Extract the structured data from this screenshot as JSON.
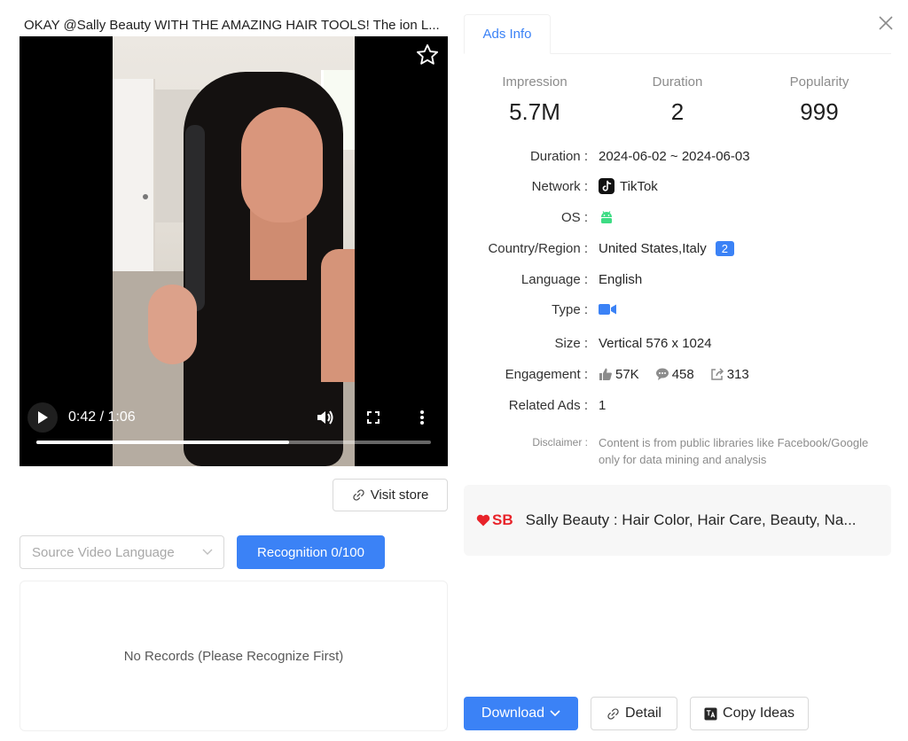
{
  "video": {
    "title": "OKAY @Sally Beauty WITH THE AMAZING HAIR TOOLS! The ion L...",
    "time": "0:42 / 1:06",
    "progress_fraction": 0.64
  },
  "left": {
    "visit_store_label": "Visit store",
    "language_placeholder": "Source Video Language",
    "recognition_label": "Recognition 0/100",
    "no_records": "No Records (Please Recognize First)"
  },
  "tabs": [
    {
      "label": "Ads Info"
    }
  ],
  "stats": [
    {
      "label": "Impression",
      "value": "5.7M"
    },
    {
      "label": "Duration",
      "value": "2"
    },
    {
      "label": "Popularity",
      "value": "999"
    }
  ],
  "details": {
    "duration_label": "Duration :",
    "duration_value": "2024-06-02 ~ 2024-06-03",
    "network_label": "Network :",
    "network_value": "TikTok",
    "os_label": "OS :",
    "os_icon": "android-icon",
    "country_label": "Country/Region :",
    "country_value": "United States,Italy",
    "country_count": "2",
    "language_label": "Language :",
    "language_value": "English",
    "type_label": "Type :",
    "type_icon": "video-camera-icon",
    "size_label": "Size :",
    "size_value": "Vertical 576 x 1024",
    "engagement_label": "Engagement :",
    "likes": "57K",
    "comments": "458",
    "shares": "313",
    "related_label": "Related Ads :",
    "related_value": "1",
    "disclaimer_label": "Disclaimer :",
    "disclaimer_text": "Content is from public libraries like Facebook/Google only for data mining and analysis"
  },
  "store": {
    "logo_text": "SB",
    "name": "Sally Beauty : Hair Color, Hair Care, Beauty, Na..."
  },
  "actions": {
    "download_label": "Download",
    "detail_label": "Detail",
    "copy_label": "Copy Ideas"
  },
  "colors": {
    "accent": "#3b82f6",
    "android": "#3ddc84",
    "brand_red": "#e8232a"
  }
}
